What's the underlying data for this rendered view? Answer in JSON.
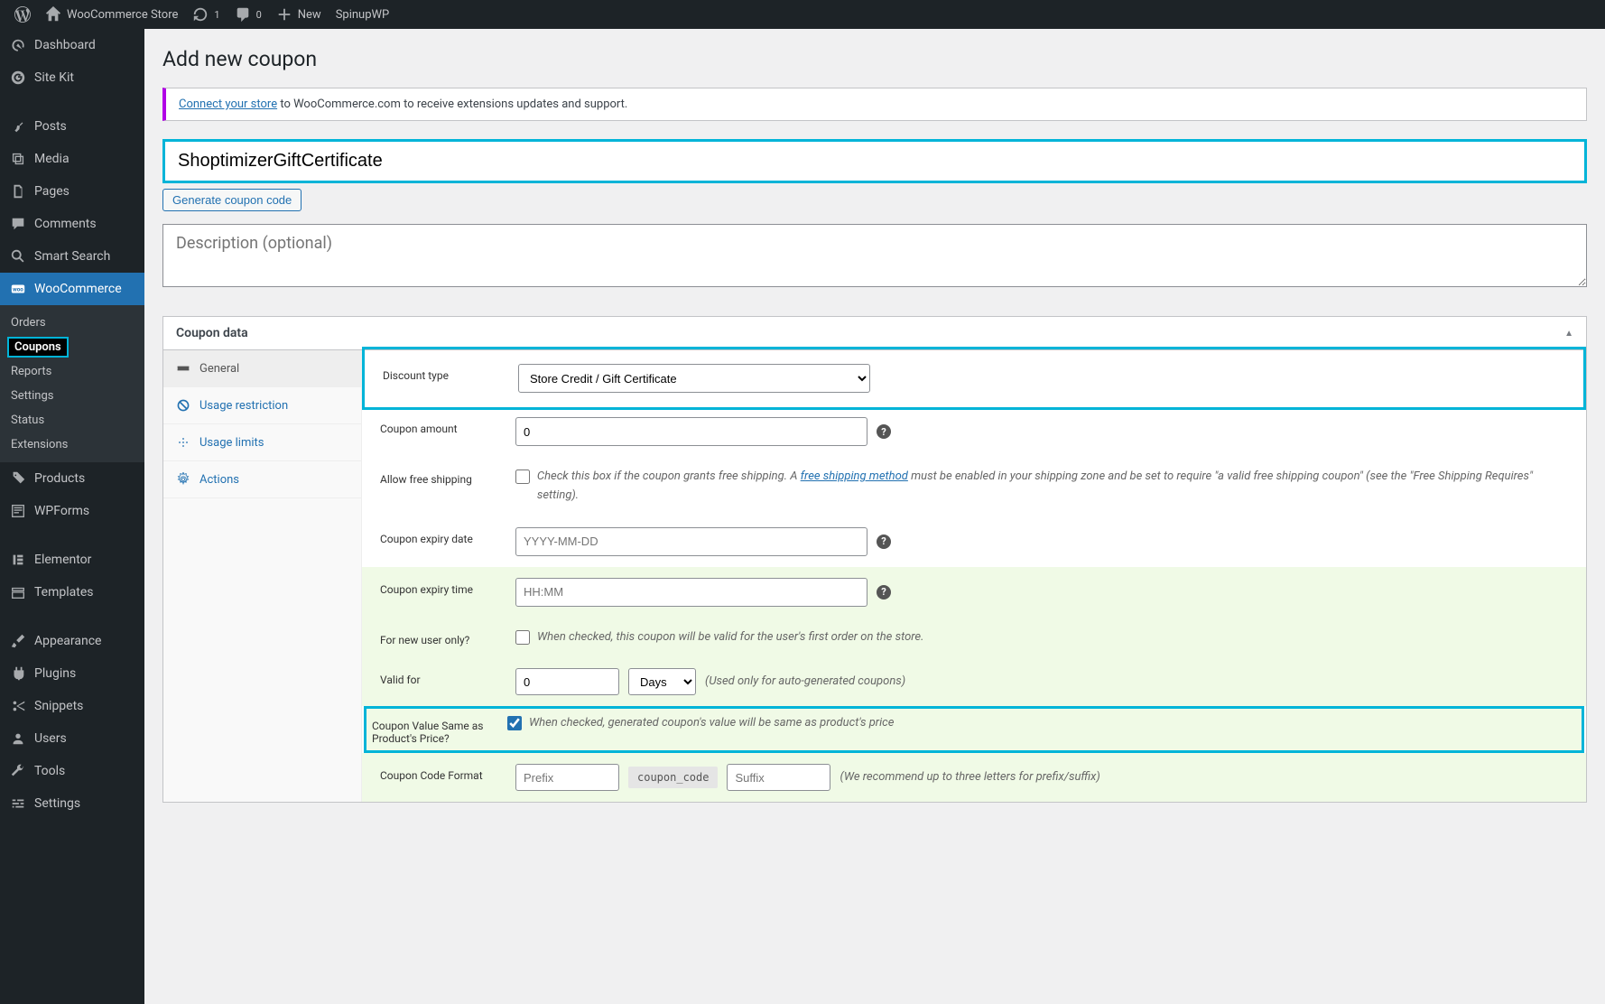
{
  "adminBar": {
    "siteName": "WooCommerce Store",
    "refreshCount": "1",
    "commentCount": "0",
    "newLabel": "New",
    "spinupLabel": "SpinupWP"
  },
  "sidebar": {
    "items": [
      {
        "label": "Dashboard",
        "icon": "dashboard"
      },
      {
        "label": "Site Kit",
        "icon": "sitekit"
      },
      {
        "label": "Posts",
        "icon": "pin"
      },
      {
        "label": "Media",
        "icon": "media"
      },
      {
        "label": "Pages",
        "icon": "pages"
      },
      {
        "label": "Comments",
        "icon": "comment"
      },
      {
        "label": "Smart Search",
        "icon": "search"
      },
      {
        "label": "WooCommerce",
        "icon": "woo"
      },
      {
        "label": "Products",
        "icon": "products"
      },
      {
        "label": "WPForms",
        "icon": "wpforms"
      },
      {
        "label": "Elementor",
        "icon": "elementor"
      },
      {
        "label": "Templates",
        "icon": "templates"
      },
      {
        "label": "Appearance",
        "icon": "appearance"
      },
      {
        "label": "Plugins",
        "icon": "plugins"
      },
      {
        "label": "Snippets",
        "icon": "snippets"
      },
      {
        "label": "Users",
        "icon": "users"
      },
      {
        "label": "Tools",
        "icon": "tools"
      },
      {
        "label": "Settings",
        "icon": "settings"
      }
    ],
    "wooSub": [
      {
        "label": "Orders"
      },
      {
        "label": "Coupons",
        "current": true
      },
      {
        "label": "Reports"
      },
      {
        "label": "Settings"
      },
      {
        "label": "Status"
      },
      {
        "label": "Extensions"
      }
    ]
  },
  "page": {
    "title": "Add new coupon",
    "noticeLink": "Connect your store",
    "noticeRest": " to WooCommerce.com to receive extensions updates and support.",
    "couponCode": "ShoptimizerGiftCertificate",
    "generateBtn": "Generate coupon code",
    "descPlaceholder": "Description (optional)"
  },
  "panel": {
    "heading": "Coupon data",
    "tabs": {
      "general": "General",
      "usageRestriction": "Usage restriction",
      "usageLimits": "Usage limits",
      "actions": "Actions"
    },
    "fields": {
      "discountType": {
        "label": "Discount type",
        "value": "Store Credit / Gift Certificate"
      },
      "couponAmount": {
        "label": "Coupon amount",
        "value": "0"
      },
      "freeShipping": {
        "label": "Allow free shipping",
        "textBefore": "Check this box if the coupon grants free shipping. A ",
        "link": "free shipping method",
        "textAfter": " must be enabled in your shipping zone and be set to require \"a valid free shipping coupon\" (see the \"Free Shipping Requires\" setting)."
      },
      "expiryDate": {
        "label": "Coupon expiry date",
        "placeholder": "YYYY-MM-DD"
      },
      "expiryTime": {
        "label": "Coupon expiry time",
        "placeholder": "HH:MM"
      },
      "newUser": {
        "label": "For new user only?",
        "note": "When checked, this coupon will be valid for the user's first order on the store."
      },
      "validFor": {
        "label": "Valid for",
        "value": "0",
        "unit": "Days",
        "note": "(Used only for auto-generated coupons)"
      },
      "sameAsPrice": {
        "label": "Coupon Value Same as Product's Price?",
        "note": "When checked, generated coupon's value will be same as product's price"
      },
      "codeFormat": {
        "label": "Coupon Code Format",
        "prefixPlaceholder": "Prefix",
        "chip": "coupon_code",
        "suffixPlaceholder": "Suffix",
        "note": "(We recommend up to three letters for prefix/suffix)"
      }
    }
  }
}
